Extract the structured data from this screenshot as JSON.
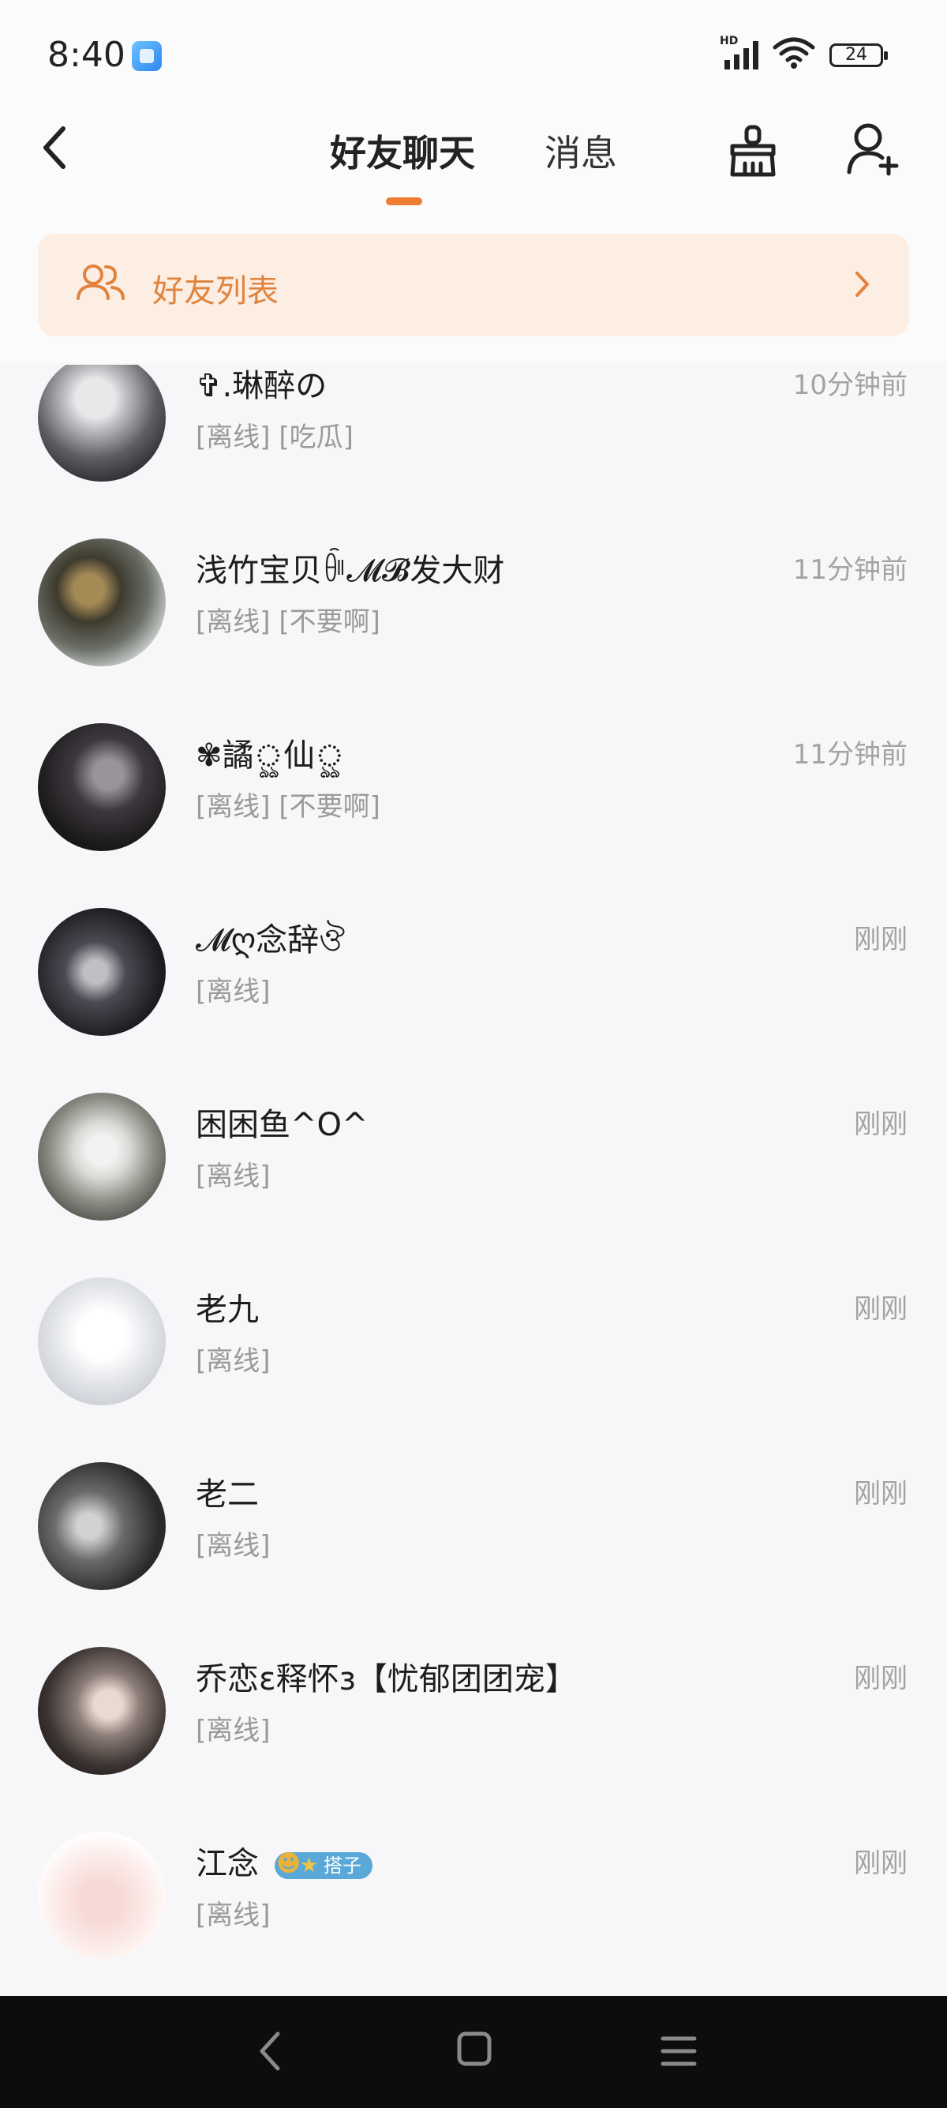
{
  "statusbar": {
    "time": "8:40",
    "battery": "24",
    "network": "HD"
  },
  "header": {
    "tabs": [
      {
        "label": "好友聊天",
        "active": true
      },
      {
        "label": "消息",
        "active": false
      }
    ],
    "accent": "#ee7d33"
  },
  "friends_banner": {
    "label": "好友列表"
  },
  "chats": [
    {
      "name": "✞.琳醉の",
      "status": "[离线] [吃瓜]",
      "time": "10分钟前"
    },
    {
      "name": "浅竹宝贝ꀼ𝓜𝓑发大财",
      "status": "[离线] [不要啊]",
      "time": "11分钟前"
    },
    {
      "name": "✾譎ৣ仙ৣ",
      "status": "[离线] [不要啊]",
      "time": "11分钟前"
    },
    {
      "name": "𝓜ღ念辞ঔ",
      "status": "[离线]",
      "time": "刚刚"
    },
    {
      "name": "困困鱼^O^",
      "status": "[离线]",
      "time": "刚刚"
    },
    {
      "name": "老九",
      "status": "[离线]",
      "time": "刚刚"
    },
    {
      "name": "老二",
      "status": "[离线]",
      "time": "刚刚"
    },
    {
      "name": "乔恋ɛ释怀ɜ【忧郁团团宠】",
      "status": "[离线]",
      "time": "刚刚"
    },
    {
      "name": "江念",
      "tag": "搭子",
      "status": "[离线]",
      "time": "刚刚"
    }
  ]
}
